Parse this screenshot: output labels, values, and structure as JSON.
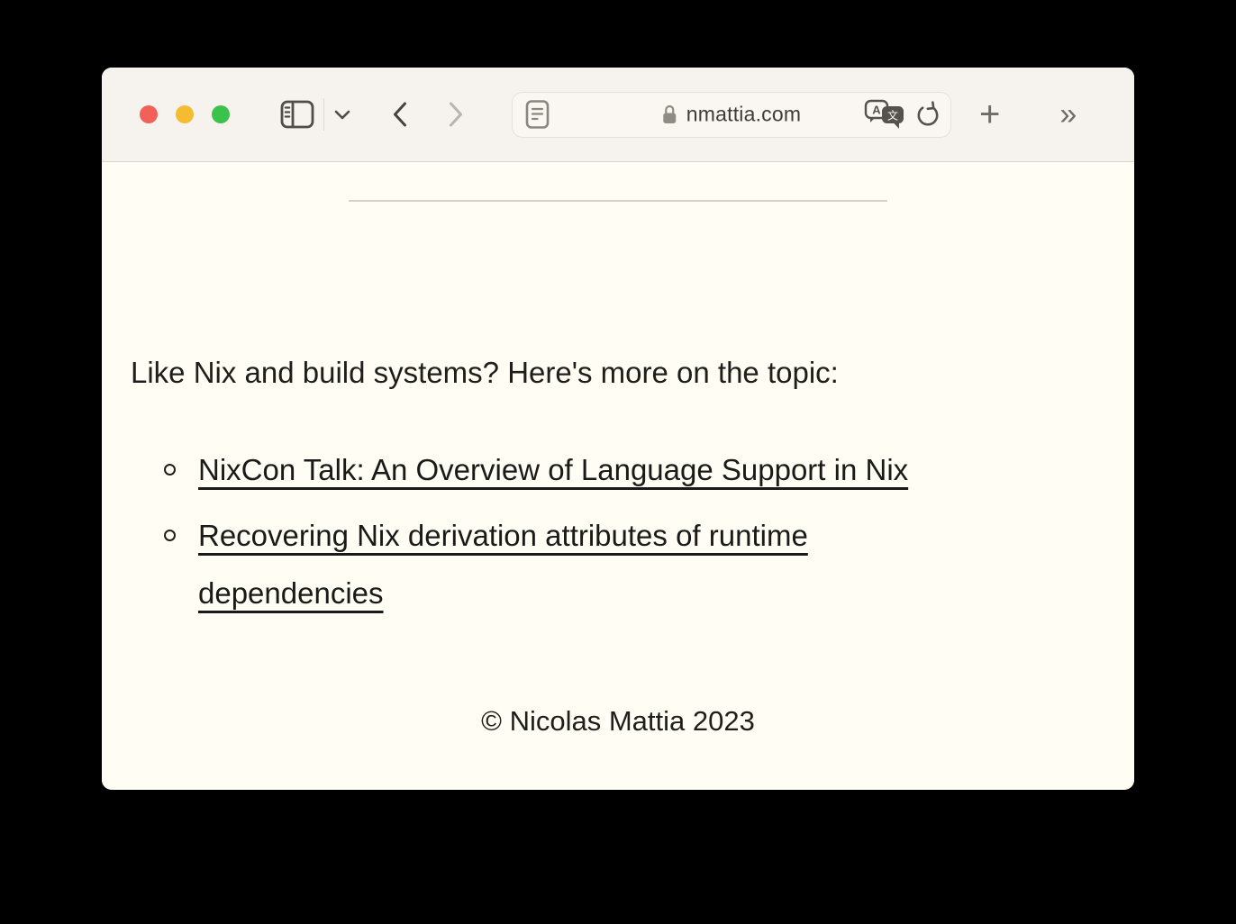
{
  "browser": {
    "url_field": {
      "domain": "nmattia.com"
    },
    "icons": {
      "traffic_lights": [
        "close",
        "minimize",
        "zoom"
      ],
      "sidebar_glyph": "sidebar-toggle",
      "tab_group_glyph": "chevron-down",
      "back_glyph": "chevron-left",
      "forward_glyph": "chevron-right",
      "reader_glyph": "reader-page",
      "lock_glyph": "padlock",
      "translate_back_letter": "A",
      "translate_front_letter": "文",
      "reload_glyph": "circular-arrow",
      "new_tab_glyph": "+",
      "overflow_glyph": "»"
    }
  },
  "page": {
    "intro": "Like Nix and build systems? Here's more on the topic:",
    "links": [
      {
        "label": "NixCon Talk: An Overview of Language Support in Nix"
      },
      {
        "label": "Recovering Nix derivation attributes of runtime dependencies"
      }
    ],
    "footer": "© Nicolas Mattia 2023"
  },
  "colors": {
    "desktop_background": "#000000",
    "toolbar_background": "#f6f2ee",
    "content_background": "#fffdf4",
    "traffic_red": "#f2605a",
    "traffic_yellow": "#f5bc31",
    "traffic_green": "#3bc24b",
    "text": "#1f1e1b",
    "divider": "#d4d2cb"
  }
}
